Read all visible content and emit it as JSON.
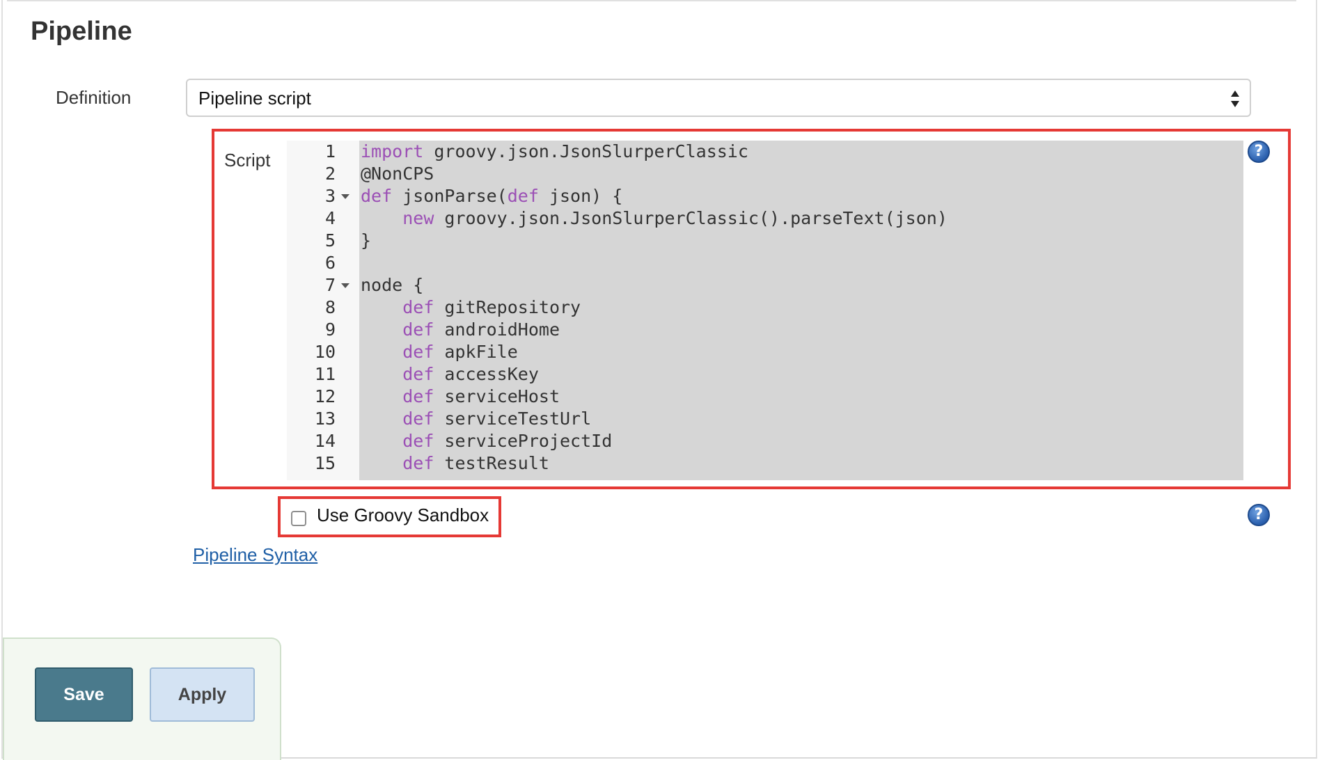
{
  "section": {
    "title": "Pipeline"
  },
  "definition": {
    "label": "Definition",
    "selected_value": "Pipeline script"
  },
  "script": {
    "label": "Script",
    "lines": [
      {
        "num": "1",
        "fold": false,
        "tokens": [
          {
            "t": "import",
            "kw": true
          },
          {
            "t": " groovy.json.JsonSlurperClassic",
            "kw": false
          }
        ]
      },
      {
        "num": "2",
        "fold": false,
        "tokens": [
          {
            "t": "@NonCPS",
            "kw": false
          }
        ]
      },
      {
        "num": "3",
        "fold": true,
        "tokens": [
          {
            "t": "def",
            "kw": true
          },
          {
            "t": " jsonParse(",
            "kw": false
          },
          {
            "t": "def",
            "kw": true
          },
          {
            "t": " json) {",
            "kw": false
          }
        ]
      },
      {
        "num": "4",
        "fold": false,
        "tokens": [
          {
            "t": "    ",
            "kw": false
          },
          {
            "t": "new",
            "kw": true
          },
          {
            "t": " groovy.json.JsonSlurperClassic().parseText(json)",
            "kw": false
          }
        ]
      },
      {
        "num": "5",
        "fold": false,
        "tokens": [
          {
            "t": "}",
            "kw": false
          }
        ]
      },
      {
        "num": "6",
        "fold": false,
        "tokens": []
      },
      {
        "num": "7",
        "fold": true,
        "tokens": [
          {
            "t": "node {",
            "kw": false
          }
        ]
      },
      {
        "num": "8",
        "fold": false,
        "tokens": [
          {
            "t": "    ",
            "kw": false
          },
          {
            "t": "def",
            "kw": true
          },
          {
            "t": " gitRepository",
            "kw": false
          }
        ]
      },
      {
        "num": "9",
        "fold": false,
        "tokens": [
          {
            "t": "    ",
            "kw": false
          },
          {
            "t": "def",
            "kw": true
          },
          {
            "t": " androidHome",
            "kw": false
          }
        ]
      },
      {
        "num": "10",
        "fold": false,
        "tokens": [
          {
            "t": "    ",
            "kw": false
          },
          {
            "t": "def",
            "kw": true
          },
          {
            "t": " apkFile",
            "kw": false
          }
        ]
      },
      {
        "num": "11",
        "fold": false,
        "tokens": [
          {
            "t": "    ",
            "kw": false
          },
          {
            "t": "def",
            "kw": true
          },
          {
            "t": " accessKey",
            "kw": false
          }
        ]
      },
      {
        "num": "12",
        "fold": false,
        "tokens": [
          {
            "t": "    ",
            "kw": false
          },
          {
            "t": "def",
            "kw": true
          },
          {
            "t": " serviceHost",
            "kw": false
          }
        ]
      },
      {
        "num": "13",
        "fold": false,
        "tokens": [
          {
            "t": "    ",
            "kw": false
          },
          {
            "t": "def",
            "kw": true
          },
          {
            "t": " serviceTestUrl",
            "kw": false
          }
        ]
      },
      {
        "num": "14",
        "fold": false,
        "tokens": [
          {
            "t": "    ",
            "kw": false
          },
          {
            "t": "def",
            "kw": true
          },
          {
            "t": " serviceProjectId",
            "kw": false
          }
        ]
      },
      {
        "num": "15",
        "fold": false,
        "tokens": [
          {
            "t": "    ",
            "kw": false
          },
          {
            "t": "def",
            "kw": true
          },
          {
            "t": " testResult",
            "kw": false
          }
        ]
      }
    ]
  },
  "sandbox": {
    "label": "Use Groovy Sandbox",
    "checked": false
  },
  "links": {
    "pipeline_syntax": "Pipeline Syntax"
  },
  "help": {
    "glyph": "?"
  },
  "buttons": {
    "save_label": "Save",
    "apply_label": "Apply"
  }
}
